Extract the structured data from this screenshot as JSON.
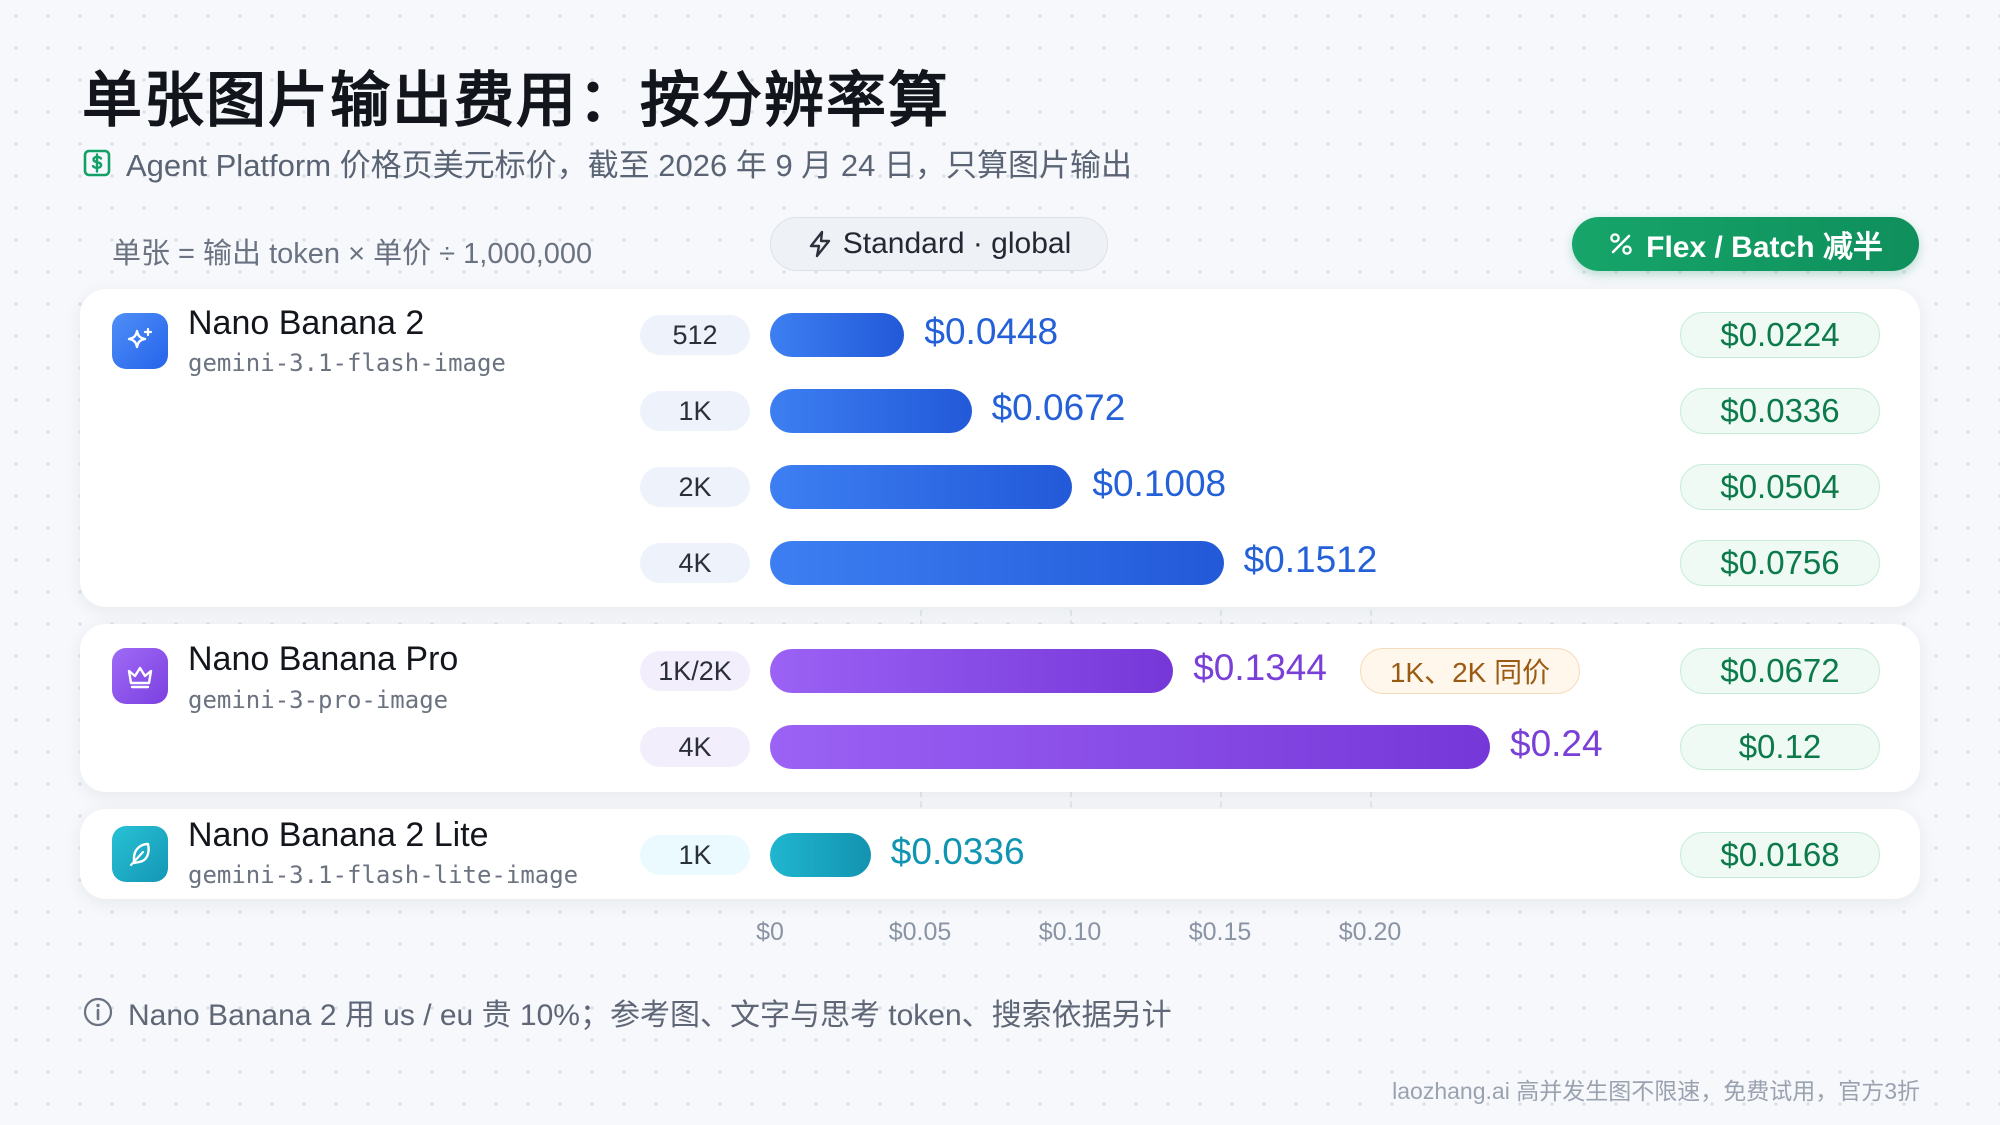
{
  "title": "单张图片输出费用：按分辨率算",
  "subtitle": "Agent Platform 价格页美元标价，截至 2026 年 9 月 24 日，只算图片输出",
  "formula": "单张 = 输出 token × 单价 ÷ 1,000,000",
  "standard_badge": "Standard · global",
  "flex_badge": "Flex / Batch 减半",
  "footnote": "Nano Banana 2 用 us / eu 贵 10%；参考图、文字与思考 token、搜索依据另计",
  "brand": "laozhang.ai 高并发生图不限速，免费试用，官方3折",
  "colors": {
    "blue": "#2461d8",
    "purple": "#7a3fd6",
    "teal": "#0f94b2",
    "green": "#13a066"
  },
  "icons": {
    "subtitle": "dollar-icon",
    "standard": "lightning-icon",
    "flex": "percent-icon",
    "footnote": "info-icon"
  },
  "models": [
    {
      "name": "Nano Banana 2",
      "code": "gemini-3.1-flash-image",
      "icon": "sparkle-icon",
      "rows": [
        {
          "label": "512",
          "value": 0.0448,
          "value_text": "$0.0448",
          "batch_text": "$0.0224"
        },
        {
          "label": "1K",
          "value": 0.0672,
          "value_text": "$0.0672",
          "batch_text": "$0.0336"
        },
        {
          "label": "2K",
          "value": 0.1008,
          "value_text": "$0.1008",
          "batch_text": "$0.0504"
        },
        {
          "label": "4K",
          "value": 0.1512,
          "value_text": "$0.1512",
          "batch_text": "$0.0756"
        }
      ]
    },
    {
      "name": "Nano Banana Pro",
      "code": "gemini-3-pro-image",
      "icon": "crown-icon",
      "rows": [
        {
          "label": "1K/2K",
          "value": 0.1344,
          "value_text": "$0.1344",
          "batch_text": "$0.0672",
          "note": "1K、2K 同价"
        },
        {
          "label": "4K",
          "value": 0.24,
          "value_text": "$0.24",
          "batch_text": "$0.12"
        }
      ]
    },
    {
      "name": "Nano Banana 2 Lite",
      "code": "gemini-3.1-flash-lite-image",
      "icon": "feather-icon",
      "rows": [
        {
          "label": "1K",
          "value": 0.0336,
          "value_text": "$0.0336",
          "batch_text": "$0.0168"
        }
      ]
    }
  ],
  "chart_data": {
    "type": "bar",
    "orientation": "horizontal",
    "title": "单张图片输出费用：按分辨率算",
    "categories": [
      "Nano Banana 2 · 512",
      "Nano Banana 2 · 1K",
      "Nano Banana 2 · 2K",
      "Nano Banana 2 · 4K",
      "Nano Banana Pro · 1K/2K",
      "Nano Banana Pro · 4K",
      "Nano Banana 2 Lite · 1K"
    ],
    "series": [
      {
        "name": "Standard · global",
        "values": [
          0.0448,
          0.0672,
          0.1008,
          0.1512,
          0.1344,
          0.24,
          0.0336
        ]
      },
      {
        "name": "Flex / Batch 减半",
        "values": [
          0.0224,
          0.0336,
          0.0504,
          0.0756,
          0.0672,
          0.12,
          0.0168
        ]
      }
    ],
    "xlim": [
      0,
      0.24
    ],
    "xticks": [
      "$0",
      "$0.05",
      "$0.10",
      "$0.15",
      "$0.20"
    ],
    "grid": true
  }
}
